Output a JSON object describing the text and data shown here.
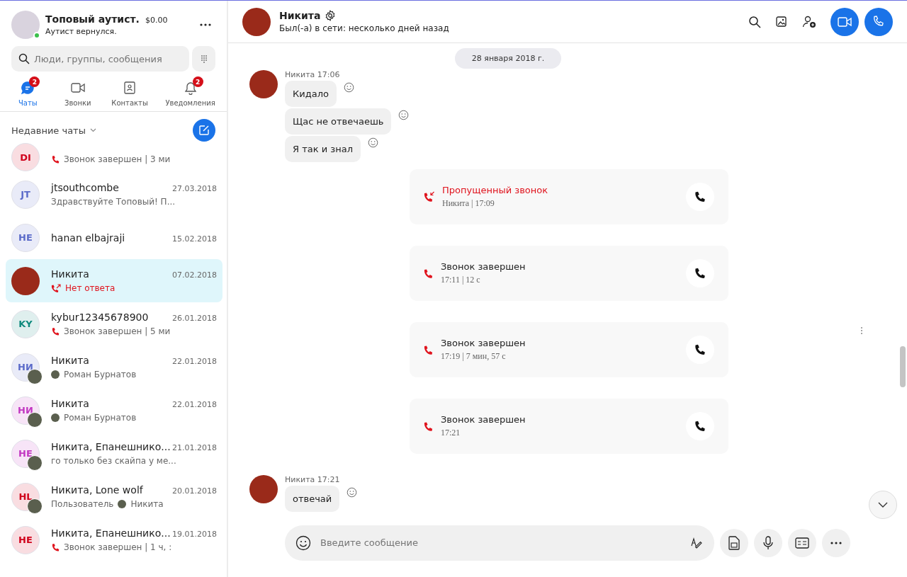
{
  "profile": {
    "name": "Топовый аутист.",
    "balance": "$0.00",
    "status": "Аутист вернулся.",
    "online": true
  },
  "search": {
    "placeholder": "Люди, группы, сообщения"
  },
  "nav_tabs": [
    {
      "kind": "chats",
      "label": "Чаты",
      "badge": "2",
      "selected": true
    },
    {
      "kind": "calls",
      "label": "Звонки",
      "selected": false
    },
    {
      "kind": "contacts",
      "label": "Контакты",
      "selected": false
    },
    {
      "kind": "notifications",
      "label": "Уведомления",
      "badge": "2",
      "selected": false
    }
  ],
  "recent_chats": {
    "title": "Недавние чаты"
  },
  "chats": [
    {
      "avatar": {
        "kind": "initials",
        "initials": "DI",
        "color": "#d0021b"
      },
      "preview": {
        "kind": "call",
        "text": "Звонок завершен | 3 ми"
      },
      "selected": false
    },
    {
      "avatar": {
        "kind": "initials",
        "initials": "JT",
        "color": "#5b6bc9"
      },
      "name": "jtsouthcombe",
      "date": "27.03.2018",
      "preview": {
        "kind": "text",
        "text": "Здравствуйте Топовый! П..."
      },
      "selected": false
    },
    {
      "avatar": {
        "kind": "initials",
        "initials": "HE",
        "color": "#5b6bc9"
      },
      "name": "hanan elbajraji",
      "date": "15.02.2018",
      "selected": false
    },
    {
      "avatar": {
        "kind": "photo"
      },
      "name": "Никита",
      "date": "07.02.2018",
      "preview": {
        "kind": "missed",
        "text": "Нет ответа"
      },
      "selected": true
    },
    {
      "avatar": {
        "kind": "initials",
        "initials": "KY",
        "color": "#0f8a7e"
      },
      "name": "kybur12345678900",
      "date": "26.01.2018",
      "preview": {
        "kind": "call",
        "text": "Звонок завершен | 5 ми"
      },
      "selected": false
    },
    {
      "avatar": {
        "kind": "initials",
        "initials": "НИ",
        "color": "#5b6bc9",
        "member_photo": true
      },
      "name": "Никита",
      "date": "22.01.2018",
      "preview": {
        "kind": "person",
        "text": "Роман Бурнатов"
      },
      "selected": false
    },
    {
      "avatar": {
        "kind": "initials",
        "initials": "НИ",
        "color": "#c238c2",
        "member_photo": true
      },
      "name": "Никита",
      "date": "22.01.2018",
      "preview": {
        "kind": "person",
        "text": "Роман Бурнатов"
      },
      "selected": false
    },
    {
      "avatar": {
        "kind": "initials",
        "initials": "НЕ",
        "color": "#c238c2",
        "member_photo": true
      },
      "name": "Никита, Епанешнико...",
      "date": "21.01.2018",
      "preview": {
        "kind": "text",
        "text": "го только без скайпа у ме..."
      },
      "selected": false
    },
    {
      "avatar": {
        "kind": "initials",
        "initials": "HL",
        "color": "#d0021b",
        "member_photo": true
      },
      "name": "Никита, Lone wolf",
      "date": "20.01.2018",
      "preview": {
        "kind": "person",
        "before": "Пользователь",
        "text": "Никита"
      },
      "selected": false
    },
    {
      "avatar": {
        "kind": "initials",
        "initials": "НЕ",
        "color": "#d0021b"
      },
      "name": "Никита, Епанешнико...",
      "date": "19.01.2018",
      "preview": {
        "kind": "call",
        "text": "Звонок завершен | 1 ч, :"
      },
      "selected": false
    }
  ],
  "conversation": {
    "name": "Никита",
    "status": "Был(-а) в сети: несколько дней назад",
    "date_divider": "28 января 2018 г.",
    "timeline": [
      {
        "kind": "messages",
        "sender": "Никита 17:06",
        "bubbles": [
          "Кидало",
          "Щас не отвечаешь",
          "Я так и знал"
        ]
      },
      {
        "kind": "call",
        "missed": true,
        "title": "Пропущенный звонок",
        "detail": "Никита | 17:09"
      },
      {
        "kind": "call",
        "missed": false,
        "title": "Звонок завершен",
        "detail": "17:11 | 12 с"
      },
      {
        "kind": "call",
        "missed": false,
        "title": "Звонок завершен",
        "detail": "17:19 | 7 мин, 57 с"
      },
      {
        "kind": "call",
        "missed": false,
        "title": "Звонок завершен",
        "detail": "17:21"
      },
      {
        "kind": "messages",
        "sender": "Никита 17:21",
        "bubbles": [
          "отвечай"
        ]
      }
    ]
  },
  "composer": {
    "placeholder": "Введите сообщение"
  }
}
